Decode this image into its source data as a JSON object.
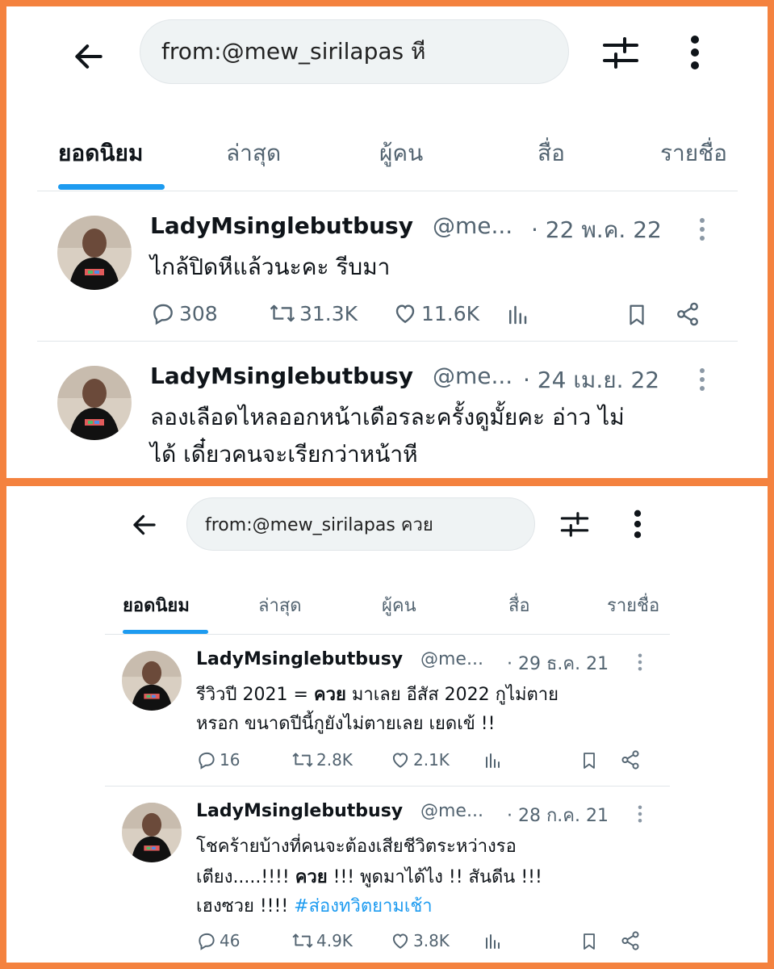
{
  "panels": [
    {
      "search_query": "from:@mew_sirilapas หี",
      "tabs": [
        "ยอดนิยม",
        "ล่าสุด",
        "ผู้คน",
        "สื่อ",
        "รายชื่อ"
      ],
      "tweets": [
        {
          "name": "LadyMsinglebutbusy",
          "handle": "@me...",
          "date": "· 22 พ.ค. 22",
          "lines": [
            "ไกล้ปิดหีแล้วนะคะ รีบมา"
          ],
          "replies": "308",
          "retweets": "31.3K",
          "likes": "11.6K"
        },
        {
          "name": "LadyMsinglebutbusy",
          "handle": "@me...",
          "date": "· 24 เม.ย. 22",
          "lines": [
            "ลองเลือดไหลออกหน้าเดือรละครั้งดูมั้ยคะ อ่าว ไม่",
            "ได้ เดี๋ยวคนจะเรียกว่าหน้าหี"
          ]
        }
      ]
    },
    {
      "search_query": "from:@mew_sirilapas ควย",
      "tabs": [
        "ยอดนิยม",
        "ล่าสุด",
        "ผู้คน",
        "สื่อ",
        "รายชื่อ"
      ],
      "tweets": [
        {
          "name": "LadyMsinglebutbusy",
          "handle": "@me...",
          "date": "· 29 ธ.ค. 21",
          "line1": {
            "a": "รีวิวปี 2021 = ",
            "bold": "ควย",
            "b": " มาเลย อีสัส 2022 กูไม่ตาย"
          },
          "line2": "หรอก ขนาดปีนี้กูยังไม่ตายเลย เยดเข้ !!",
          "replies": "16",
          "retweets": "2.8K",
          "likes": "2.1K"
        },
        {
          "name": "LadyMsinglebutbusy",
          "handle": "@me...",
          "date": "· 28 ก.ค. 21",
          "line1": "โชคร้ายบ้างที่คนจะต้องเสียชีวิตระหว่างรอ",
          "line2": {
            "a": "เตียง.....!!!! ",
            "bold": "ควย",
            "b": " !!! พูดมาได้ไง !! สันดีน !!!"
          },
          "line3": {
            "a": "เฮงซวย !!!! ",
            "hashtag": "#ส่องทวิตยามเช้า"
          },
          "replies": "46",
          "retweets": "4.9K",
          "likes": "3.8K"
        }
      ]
    }
  ],
  "icons": [
    "back-arrow-icon",
    "filter-sliders-icon",
    "more-vertical-icon",
    "reply-icon",
    "retweet-icon",
    "like-icon",
    "views-icon",
    "bookmark-icon",
    "share-icon"
  ],
  "colors": {
    "frame": "#f4823f",
    "accent": "#1d9bf0",
    "muted": "#536471"
  }
}
